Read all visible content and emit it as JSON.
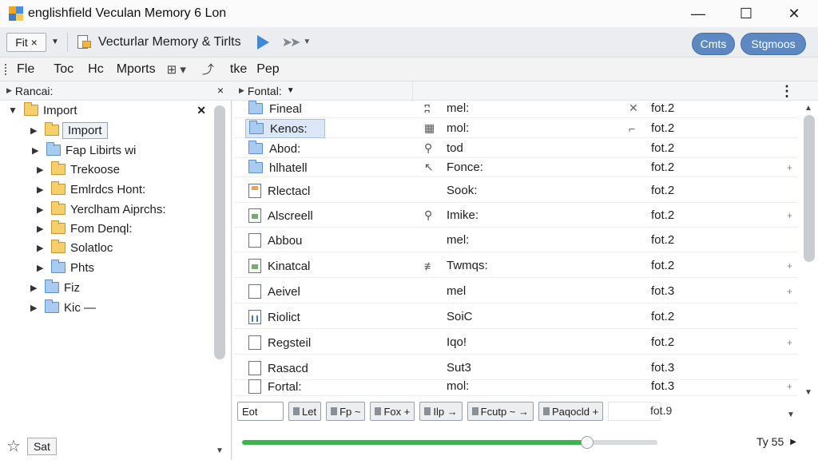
{
  "window": {
    "title": "englishfield Veculan Memory 6 Lon",
    "controls": [
      "—",
      "☐",
      "✕"
    ]
  },
  "toolbar": {
    "combo_value": "Fit ×",
    "project_label": "Vecturlar Memory & Tirlts",
    "pill_left": "Cmts",
    "pill_right": "Stgmoos"
  },
  "menu": {
    "items": [
      "Fle",
      "Toc",
      "Hc",
      "Mports",
      "tke",
      "Pep"
    ]
  },
  "left_panel": {
    "header": "Rancai:",
    "close": "×",
    "tree": [
      {
        "label": "Import",
        "expanded": true,
        "color": "yellow"
      },
      {
        "label": "Import",
        "selected": true,
        "color": "yellow"
      },
      {
        "label": "Fap Libirts wi",
        "color": "blue"
      },
      {
        "label": "Trekoose",
        "color": "yellow"
      },
      {
        "label": "Emlrdcs Hont:",
        "color": "yellow"
      },
      {
        "label": "Yerclham Aiprchs:",
        "color": "yellow"
      },
      {
        "label": "Fom Denql:",
        "color": "yellow"
      },
      {
        "label": "Solatloc",
        "color": "yellow"
      },
      {
        "label": "Phts",
        "color": "blue"
      },
      {
        "label": "Fiz",
        "color": "blue"
      },
      {
        "label": "Kic —",
        "color": "blue"
      }
    ],
    "footer_button": "Sat"
  },
  "right_panel": {
    "header": "Fontal:",
    "rows": [
      {
        "name": "Fineal",
        "c2icon": "ʭ",
        "c2": "mel:",
        "c3icon": "✕",
        "c3": "fot.2",
        "plus": false,
        "icon": "folder"
      },
      {
        "name": "Kenos:",
        "c2icon": "▦",
        "c2": "mol:",
        "c3icon": "⌐",
        "c3": "fot.2",
        "plus": false,
        "icon": "folder",
        "selected": true
      },
      {
        "name": "Abod:",
        "c2icon": "⚲",
        "c2": "tod",
        "c3icon": "",
        "c3": "fot.2",
        "plus": false,
        "icon": "folder"
      },
      {
        "name": "hlhatell",
        "c2icon": "↖",
        "c2": "Fonce:",
        "c3icon": "",
        "c3": "fot.2",
        "plus": true,
        "icon": "folder"
      },
      {
        "name": "Rlectacl",
        "c2icon": "",
        "c2": "Sook:",
        "c3icon": "",
        "c3": "fot.2",
        "plus": false,
        "icon": "doc-o"
      },
      {
        "name": "Alscreell",
        "c2icon": "⚲",
        "c2": "Imike:",
        "c3icon": "",
        "c3": "fot.2",
        "plus": true,
        "icon": "doc-g"
      },
      {
        "name": "Abbou",
        "c2icon": "",
        "c2": "mel:",
        "c3icon": "",
        "c3": "fot.2",
        "plus": false,
        "icon": "doc"
      },
      {
        "name": "Kinatcal",
        "c2icon": "≢",
        "c2": "Twmqs:",
        "c3icon": "",
        "c3": "fot.2",
        "plus": true,
        "icon": "doc-g"
      },
      {
        "name": "Aeivel",
        "c2icon": "",
        "c2": "mel",
        "c3icon": "",
        "c3": "fot.3",
        "plus": true,
        "icon": "doc"
      },
      {
        "name": "Riolict",
        "c2icon": "",
        "c2": "SoiC",
        "c3icon": "",
        "c3": "fot.2",
        "plus": false,
        "icon": "doc-b"
      },
      {
        "name": "Regsteil",
        "c2icon": "",
        "c2": "Iqo!",
        "c3icon": "",
        "c3": "fot.2",
        "plus": true,
        "icon": "doc"
      },
      {
        "name": "Rasacd",
        "c2icon": "",
        "c2": "Sut3",
        "c3icon": "",
        "c3": "fot.3",
        "plus": false,
        "icon": "doc"
      },
      {
        "name": "Fortal:",
        "c2icon": "",
        "c2": "mol:",
        "c3icon": "",
        "c3": "fot.3",
        "plus": true,
        "icon": "doc"
      }
    ],
    "filter_chips": [
      "Eot",
      "Let",
      "Fp ~",
      "Fox +",
      "Ilp →",
      "Fcutp ~ →",
      "Paqocld +"
    ],
    "filter_value": "fot.9",
    "progress": 0.83,
    "zoom_text": "Ty 55"
  },
  "colors": {
    "accent": "#3e88d4",
    "progress": "#3fb34f",
    "pill": "#5d88c1",
    "selection": "#dbe7f6"
  }
}
